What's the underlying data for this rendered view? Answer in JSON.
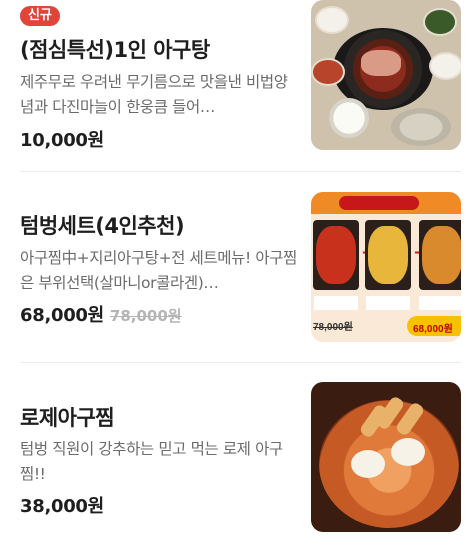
{
  "menu_items": [
    {
      "badge": "신규",
      "title": "(점심특선)1인 아구탕",
      "description": "제주무로 우려낸 무기름으로 맛을낸 비법양념과 다진마늘이 한웅큼 들어…",
      "price": "10,000원",
      "old_price": null,
      "image_name": "agutang-meal-photo"
    },
    {
      "badge": null,
      "title": "텀벙세트(4인추천)",
      "description": "아구찜中+지리아구탕+전 세트메뉴! 아구찜은 부위선택(살마니or콜라겐)…",
      "price": "68,000원",
      "old_price": "78,000원",
      "image_name": "set-menu-poster",
      "image_text": {
        "old": "78,000원",
        "new": "68,000원"
      }
    },
    {
      "badge": null,
      "title": "로제아구찜",
      "description": "텀벙 직원이 강추하는 믿고 먹는 로제 아구찜!!",
      "price": "38,000원",
      "old_price": null,
      "image_name": "rose-agujjim-photo"
    }
  ],
  "colors": {
    "badge_bg": "#e0453a",
    "title": "#1e1e1e",
    "description": "#6b6b6b",
    "old_price": "#b5b5b5",
    "divider": "#ececec"
  }
}
